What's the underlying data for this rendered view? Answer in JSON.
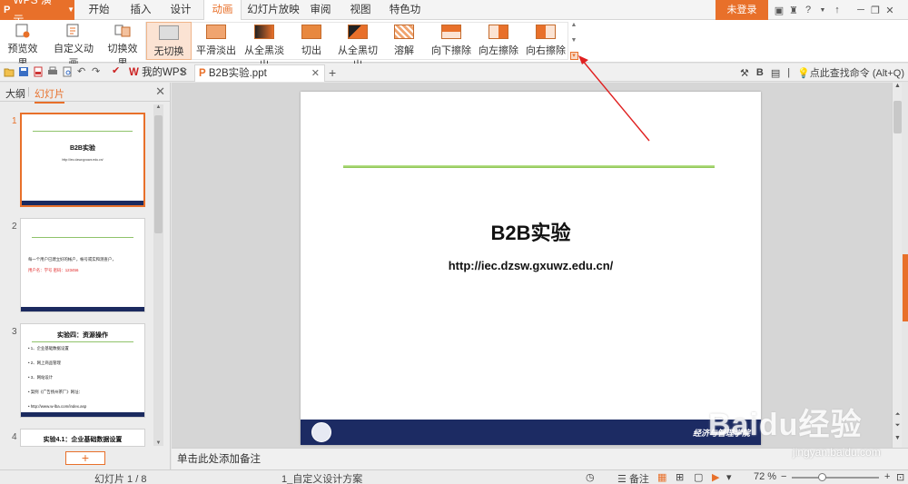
{
  "app": {
    "name": "WPS 演示"
  },
  "menu": {
    "tabs": [
      "开始",
      "插入",
      "设计",
      "动画",
      "幻灯片放映",
      "审阅",
      "视图",
      "特色功能"
    ],
    "active_tab": "动画",
    "login_label": "未登录"
  },
  "ribbon": {
    "preview_label": "预览效果",
    "custom_anim_label": "自定义动画",
    "transition_label": "切换效果",
    "transitions": [
      "无切换",
      "平滑淡出",
      "从全黑淡出",
      "切出",
      "从全黑切出",
      "溶解",
      "向下擦除",
      "向左擦除",
      "向右擦除"
    ],
    "selected_transition": "无切换"
  },
  "tabs": {
    "home_tab": "我的WPS",
    "doc_tab": "B2B实验.ppt",
    "find_command": "点此查找命令 (Alt+Q)"
  },
  "panel": {
    "outline_tab": "大纲",
    "slides_tab": "幻灯片",
    "slides": [
      {
        "num": "1",
        "title": "B2B实验",
        "sub": "http://iec.dzsw.gxuwz.edu.cn/"
      },
      {
        "num": "2",
        "line1": "每一个用户已建立好的帐户，帐号或实和测查户，",
        "line2": "用户名：学号  密码：123456"
      },
      {
        "num": "3",
        "title": "实验四：资源操作",
        "items": [
          "1、企业基础数据设置",
          "2、网上商品管理",
          "3、网站设计",
          "案例《广告扬州茶厂》网址：",
          "http://www.w-lba.com/index.asp"
        ]
      },
      {
        "num": "4",
        "title": "实验4.1：企业基础数据设置"
      }
    ]
  },
  "slide": {
    "title": "B2B实验",
    "url": "http://iec.dzsw.gxuwz.edu.cn/",
    "footer_text": "经济与管理学院"
  },
  "notes": {
    "placeholder": "单击此处添加备注"
  },
  "status": {
    "slide_counter": "幻灯片 1 / 8",
    "theme": "1_自定义设计方案",
    "notes_label": "备注",
    "zoom": "72 %"
  },
  "watermark": {
    "brand": "Baidu经验",
    "url": "jingyan.baidu.com"
  },
  "colors": {
    "accent": "#e8702a",
    "slide_footer": "#1c2b63",
    "slide_line": "#8cc24f"
  }
}
